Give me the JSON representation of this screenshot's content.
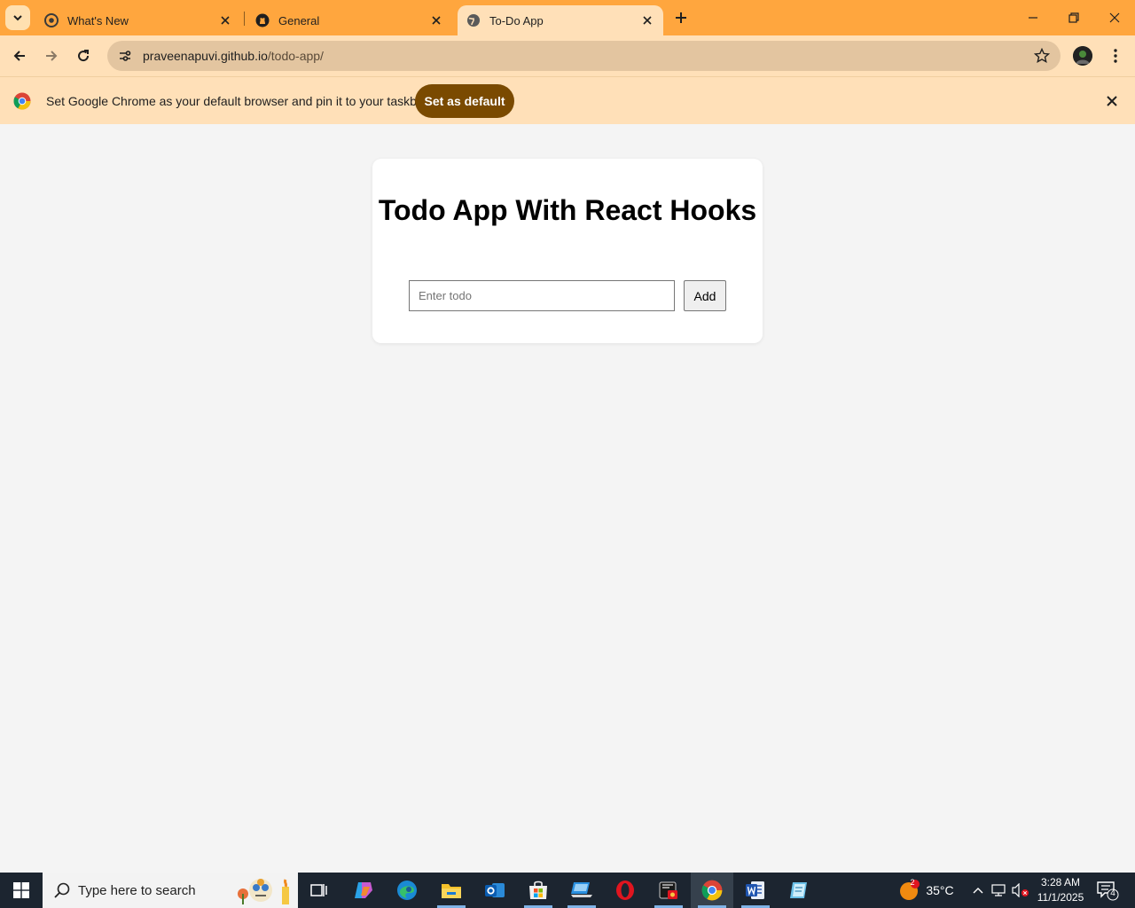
{
  "browser": {
    "tabs": [
      {
        "title": "What's New",
        "favicon": "chrome-icon",
        "active": false
      },
      {
        "title": "General",
        "favicon": "github-icon",
        "active": false
      },
      {
        "title": "To-Do App",
        "favicon": "globe-icon",
        "active": true
      }
    ],
    "url_host": "praveenapuvi.github.io",
    "url_path": "/todo-app/",
    "accent_color": "#ffa63e",
    "toolbar_color": "#ffe0b8"
  },
  "infobar": {
    "message": "Set Google Chrome as your default browser and pin it to your taskbar",
    "button_label": "Set as default"
  },
  "app": {
    "title": "Todo App With React Hooks",
    "input_placeholder": "Enter todo",
    "input_value": "",
    "add_label": "Add"
  },
  "taskbar": {
    "search_placeholder": "Type here to search",
    "apps": [
      "task-view-icon",
      "copilot-icon",
      "edge-icon",
      "file-explorer-icon",
      "outlook-icon",
      "ms-store-icon",
      "laptop-app-icon",
      "opera-icon",
      "media-app-icon",
      "chrome-icon",
      "word-icon",
      "notepad-app-icon"
    ],
    "weather_temp": "35°C",
    "weather_badge": "2",
    "time": "3:28 AM",
    "date": "11/1/2025",
    "notification_count": "4"
  }
}
